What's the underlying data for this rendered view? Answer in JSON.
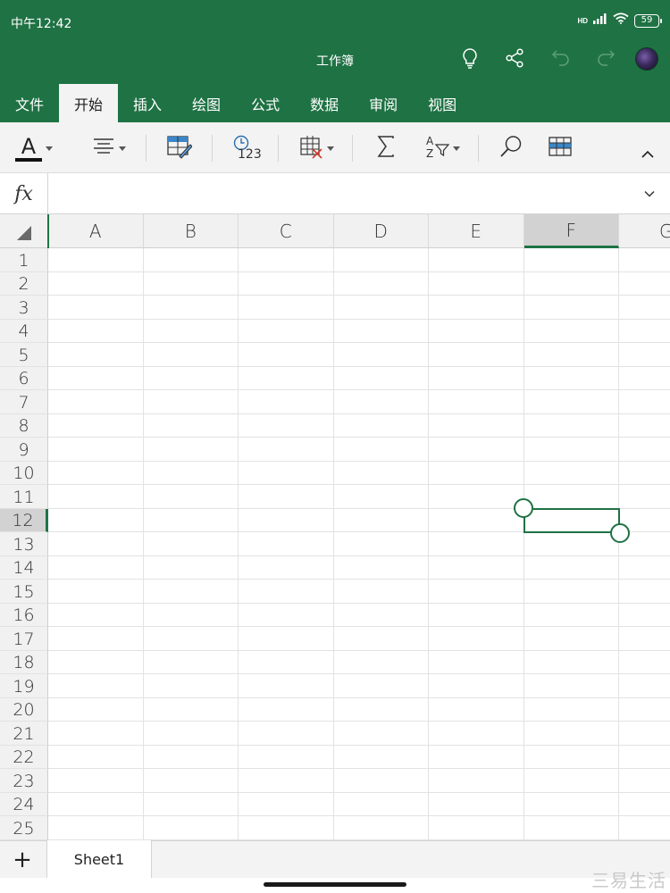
{
  "status_bar": {
    "time": "中午12:42",
    "battery": "59",
    "network": "HD"
  },
  "header": {
    "title": "工作簿",
    "icons": [
      "lightbulb-icon",
      "share-icon",
      "undo-icon",
      "redo-icon",
      "avatar"
    ]
  },
  "tabs": [
    {
      "label": "文件",
      "active": false
    },
    {
      "label": "开始",
      "active": true
    },
    {
      "label": "插入",
      "active": false
    },
    {
      "label": "绘图",
      "active": false
    },
    {
      "label": "公式",
      "active": false
    },
    {
      "label": "数据",
      "active": false
    },
    {
      "label": "审阅",
      "active": false
    },
    {
      "label": "视图",
      "active": false
    }
  ],
  "ribbon": {
    "font_color_glyph": "A",
    "number_format_glyph": "123",
    "sort_filter_glyph_top": "A",
    "sort_filter_glyph_bottom": "Z",
    "icons": [
      "font-color-icon",
      "align-icon",
      "fill-style-icon",
      "number-format-icon",
      "insert-delete-cells-icon",
      "autosum-icon",
      "sort-filter-icon",
      "search-icon",
      "table-format-icon",
      "collapse-ribbon-icon"
    ]
  },
  "formula_bar": {
    "fx_label": "fx",
    "value": ""
  },
  "grid": {
    "columns": [
      "A",
      "B",
      "C",
      "D",
      "E",
      "F",
      "G"
    ],
    "rows": [
      "1",
      "2",
      "3",
      "4",
      "5",
      "6",
      "7",
      "8",
      "9",
      "10",
      "11",
      "12",
      "13",
      "14",
      "15",
      "16",
      "17",
      "18",
      "19",
      "20",
      "21",
      "22",
      "23",
      "24",
      "25"
    ],
    "selected_column": "F",
    "selected_row": "12",
    "selected_cell": "F12"
  },
  "sheets": {
    "add_label": "+",
    "tabs": [
      "Sheet1"
    ]
  },
  "watermark": "三易生活",
  "colors": {
    "accent": "#1f7244",
    "ribbon_bg": "#f3f3f3",
    "header_bg": "#f1f1f1",
    "selected_header_bg": "#d2d2d2",
    "gridline": "#e2e2e2"
  }
}
